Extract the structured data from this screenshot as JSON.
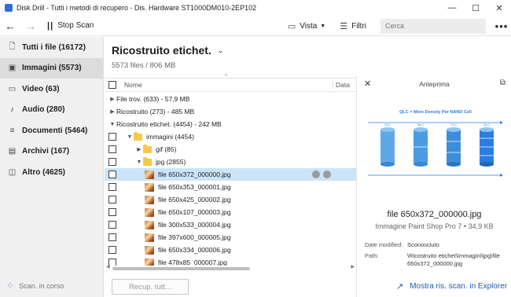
{
  "window": {
    "title": "Disk Drill - Tutti i metodi di recupero - Dis. Hardware ST1000DM010-2EP102",
    "min": "—",
    "max": "☐",
    "close": "✕"
  },
  "toolbar": {
    "back": "←",
    "forward": "→",
    "stop_label": "Stop Scan",
    "view_label": "Vista",
    "filter_label": "Filtri",
    "search_placeholder": "Cerca",
    "more": "•••"
  },
  "sidebar": {
    "items": [
      {
        "label": "Tutti i file (16172)",
        "icon": "file-icon"
      },
      {
        "label": "Immagini (5573)",
        "icon": "image-icon"
      },
      {
        "label": "Video (63)",
        "icon": "video-icon"
      },
      {
        "label": "Audio (280)",
        "icon": "music-icon"
      },
      {
        "label": "Documenti (5464)",
        "icon": "document-icon"
      },
      {
        "label": "Archivi (167)",
        "icon": "archive-icon"
      },
      {
        "label": "Altro (4625)",
        "icon": "other-icon"
      }
    ],
    "footer": "Scan. in corso"
  },
  "main": {
    "title": "Ricostruito etichet.",
    "subtitle": "5573 files / 806 MB",
    "col_name": "Nome",
    "col_date": "Data",
    "rows": [
      {
        "label": "File trov. (633) - 57,9 MB"
      },
      {
        "label": "Ricostruito (273) - 485 MB"
      },
      {
        "label": "Ricostruito etichet. (4454) - 242 MB"
      },
      {
        "label": "immagini (4454)"
      },
      {
        "label": "gif (85)"
      },
      {
        "label": "jpg (2855)"
      },
      {
        "label": "file 650x372_000000.jpg"
      },
      {
        "label": "file 650x353_000001.jpg"
      },
      {
        "label": "file 650x425_000002.jpg"
      },
      {
        "label": "file 650x107_000003.jpg"
      },
      {
        "label": "file 300x533_000004.jpg"
      },
      {
        "label": "file 397x600_000005.jpg"
      },
      {
        "label": "file 650x334_000006.jpg"
      },
      {
        "label": "file 478x85_000007.jpg"
      }
    ],
    "recover_button": "Recup. tutt..."
  },
  "preview": {
    "heading": "Anteprima",
    "image_title": "QLC = More Density Per NAND Cell",
    "cell_labels": [
      "SLC",
      "MLC",
      "TLC",
      "QLC"
    ],
    "filename": "file 650x372_000000.jpg",
    "meta": "Immagine Paint Shop Pro 7 • 34,9 KB",
    "date_key": "Date modified:",
    "date_val": "Sconosciuto",
    "path_key": "Path:",
    "path_val": "\\Ricostruito etichet\\Immagini\\jpg\\file 650x372_000000.jpg"
  },
  "explorer_link": "Mostra ris. scan. in Explorer"
}
